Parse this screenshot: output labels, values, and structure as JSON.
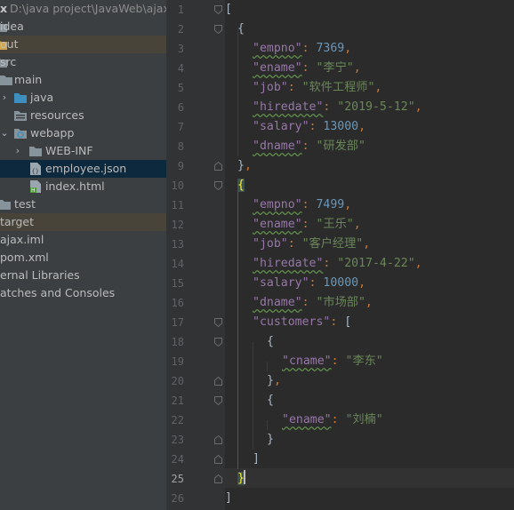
{
  "colors": {
    "tree_bg": "#3c3f41",
    "gutter_bg": "#313335",
    "editor_bg": "#2b2b2b",
    "json_key": "#9876aa",
    "json_string": "#6a8759",
    "json_number": "#6897bb",
    "punctuation": "#cc7832",
    "bracket_match": "#ffef28",
    "selection": "#0d293e",
    "excluded_row": "#49443a"
  },
  "project_tree": {
    "rows": [
      {
        "label": "x",
        "path": "D:\\java project\\JavaWeb\\ajax\\a",
        "icon": "project-root-icon",
        "state": "normal"
      },
      {
        "label": "idea",
        "icon": "folder-icon",
        "state": "normal"
      },
      {
        "label": "out",
        "icon": "folder-icon",
        "state": "excluded"
      },
      {
        "label": "src",
        "icon": "folder-icon",
        "state": "normal"
      },
      {
        "label": "main",
        "icon": "folder-icon",
        "state": "normal"
      },
      {
        "label": "java",
        "icon": "source-folder-icon",
        "state": "normal"
      },
      {
        "label": "resources",
        "icon": "resources-folder-icon",
        "state": "normal"
      },
      {
        "label": "webapp",
        "icon": "web-folder-icon",
        "state": "normal"
      },
      {
        "label": "WEB-INF",
        "icon": "folder-icon",
        "state": "normal"
      },
      {
        "label": "employee.json",
        "icon": "json-file-icon",
        "state": "selected"
      },
      {
        "label": "index.html",
        "icon": "html-file-icon",
        "state": "normal"
      },
      {
        "label": "test",
        "icon": "folder-icon",
        "state": "normal"
      },
      {
        "label": "target",
        "icon": "folder-icon",
        "state": "excluded"
      },
      {
        "label": "ajax.iml",
        "icon": "iml-file-icon",
        "state": "normal"
      },
      {
        "label": "pom.xml",
        "icon": "maven-file-icon",
        "state": "normal"
      },
      {
        "label": "ernal Libraries",
        "icon": "libraries-icon",
        "state": "normal"
      },
      {
        "label": "atches and Consoles",
        "icon": "scratches-icon",
        "state": "normal"
      }
    ]
  },
  "editor": {
    "file_name": "employee.json",
    "current_line": 25,
    "line_numbers": [
      "1",
      "2",
      "3",
      "4",
      "5",
      "6",
      "7",
      "8",
      "9",
      "10",
      "11",
      "12",
      "13",
      "14",
      "15",
      "16",
      "17",
      "18",
      "19",
      "20",
      "21",
      "22",
      "23",
      "24",
      "25",
      "26"
    ],
    "lines": [
      [
        [
          "b",
          "["
        ]
      ],
      [
        [
          "b",
          "{"
        ]
      ],
      [
        [
          "k",
          "\"empno\""
        ],
        [
          "p",
          ": "
        ],
        [
          "n",
          "7369"
        ],
        [
          "p",
          ","
        ]
      ],
      [
        [
          "k",
          "\"ename\""
        ],
        [
          "p",
          ": "
        ],
        [
          "s",
          "\"李宁\""
        ],
        [
          "p",
          ","
        ]
      ],
      [
        [
          "k",
          "\"job\""
        ],
        [
          "p",
          ": "
        ],
        [
          "s",
          "\"软件工程师\""
        ],
        [
          "p",
          ","
        ]
      ],
      [
        [
          "k",
          "\"hiredate\""
        ],
        [
          "p",
          ": "
        ],
        [
          "s",
          "\"2019-5-12\""
        ],
        [
          "p",
          ","
        ]
      ],
      [
        [
          "k",
          "\"salary\""
        ],
        [
          "p",
          ": "
        ],
        [
          "n",
          "13000"
        ],
        [
          "p",
          ","
        ]
      ],
      [
        [
          "k",
          "\"dname\""
        ],
        [
          "p",
          ": "
        ],
        [
          "s",
          "\"研发部\""
        ]
      ],
      [
        [
          "b",
          "}"
        ],
        [
          "p",
          ","
        ]
      ],
      [
        [
          "b",
          "{"
        ]
      ],
      [
        [
          "k",
          "\"empno\""
        ],
        [
          "p",
          ": "
        ],
        [
          "n",
          "7499"
        ],
        [
          "p",
          ","
        ]
      ],
      [
        [
          "k",
          "\"ename\""
        ],
        [
          "p",
          ": "
        ],
        [
          "s",
          "\"王乐\""
        ],
        [
          "p",
          ","
        ]
      ],
      [
        [
          "k",
          "\"job\""
        ],
        [
          "p",
          ": "
        ],
        [
          "s",
          "\"客户经理\""
        ],
        [
          "p",
          ","
        ]
      ],
      [
        [
          "k",
          "\"hiredate\""
        ],
        [
          "p",
          ": "
        ],
        [
          "s",
          "\"2017-4-22\""
        ],
        [
          "p",
          ","
        ]
      ],
      [
        [
          "k",
          "\"salary\""
        ],
        [
          "p",
          ": "
        ],
        [
          "n",
          "10000"
        ],
        [
          "p",
          ","
        ]
      ],
      [
        [
          "k",
          "\"dname\""
        ],
        [
          "p",
          ": "
        ],
        [
          "s",
          "\"市场部\""
        ],
        [
          "p",
          ","
        ]
      ],
      [
        [
          "k",
          "\"customers\""
        ],
        [
          "p",
          ": "
        ],
        [
          "b",
          "["
        ]
      ],
      [
        [
          "b",
          "{"
        ]
      ],
      [
        [
          "k",
          "\"cname\""
        ],
        [
          "p",
          ": "
        ],
        [
          "s",
          "\"李东\""
        ]
      ],
      [
        [
          "b",
          "}"
        ],
        [
          "p",
          ","
        ]
      ],
      [
        [
          "b",
          "{"
        ]
      ],
      [
        [
          "k",
          "\"ename\""
        ],
        [
          "p",
          ": "
        ],
        [
          "s",
          "\"刘楠\""
        ]
      ],
      [
        [
          "b",
          "}"
        ]
      ],
      [
        [
          "b",
          "]"
        ]
      ],
      [
        [
          "b",
          "}"
        ]
      ],
      [
        [
          "b",
          "]"
        ]
      ]
    ]
  }
}
